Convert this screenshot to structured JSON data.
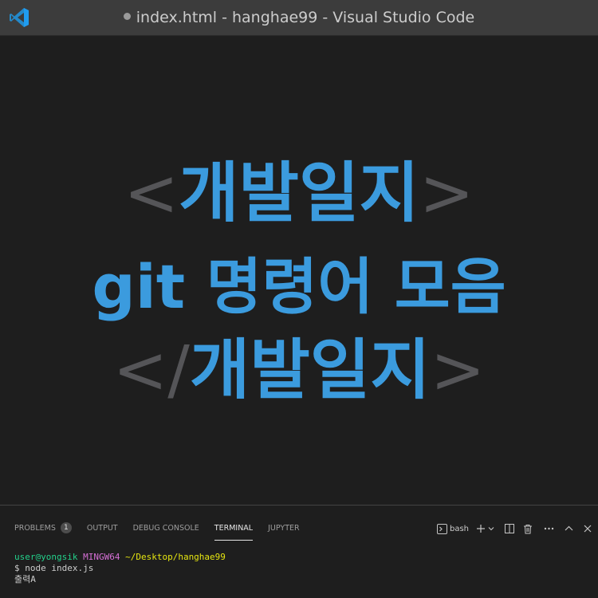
{
  "titlebar": {
    "app_icon": "vscode-logo-icon",
    "title": "index.html - hanghae99 - Visual Studio Code",
    "unsaved_indicator": "dirty-dot-icon"
  },
  "editor": {
    "line1": {
      "open": "<",
      "text": "개발일지",
      "close": ">"
    },
    "line2": {
      "text": "git 명령어 모음"
    },
    "line3": {
      "open": "</",
      "text": "개발일지",
      "close": ">"
    },
    "colors": {
      "accent": "#3b9bde",
      "bracket": "#555558",
      "background": "#1e1e1e"
    }
  },
  "panel": {
    "tabs": [
      {
        "label": "PROBLEMS",
        "badge": "1"
      },
      {
        "label": "OUTPUT"
      },
      {
        "label": "DEBUG CONSOLE"
      },
      {
        "label": "TERMINAL",
        "active": true
      },
      {
        "label": "JUPYTER"
      }
    ],
    "actions": {
      "terminal_name": "bash",
      "icons": [
        "terminal-icon",
        "plus-icon",
        "chevron-down-icon",
        "split-icon",
        "trash-icon",
        "more-icon",
        "chevron-up-icon",
        "close-icon"
      ]
    },
    "terminal": {
      "prompt_user": "user@yongsik",
      "prompt_host": "MINGW64",
      "prompt_path": "~/Desktop/hanghae99",
      "command": "$ node index.js",
      "output": "출력A"
    }
  }
}
